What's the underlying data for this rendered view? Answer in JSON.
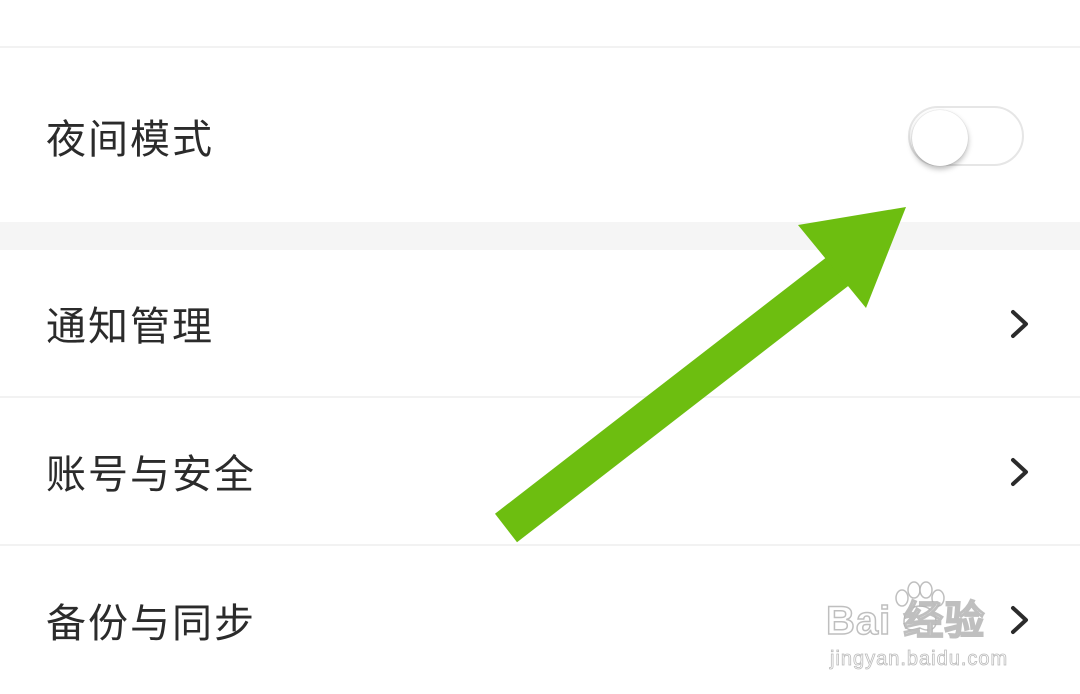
{
  "settings": {
    "night_mode": {
      "label": "夜间模式",
      "enabled": false
    },
    "notify": {
      "label": "通知管理"
    },
    "account": {
      "label": "账号与安全"
    },
    "backup": {
      "label": "备份与同步"
    }
  },
  "watermark": {
    "brand": "Bai  经验",
    "url": "jingyan.baidu.com"
  },
  "colors": {
    "arrow": "#6dbe10",
    "text": "#2b2b2b",
    "divider": "#f5f5f5"
  },
  "icons": {
    "chevron": "chevron-right-icon",
    "arrow": "arrow-annotation-icon",
    "paw": "baidu-paw-icon"
  }
}
